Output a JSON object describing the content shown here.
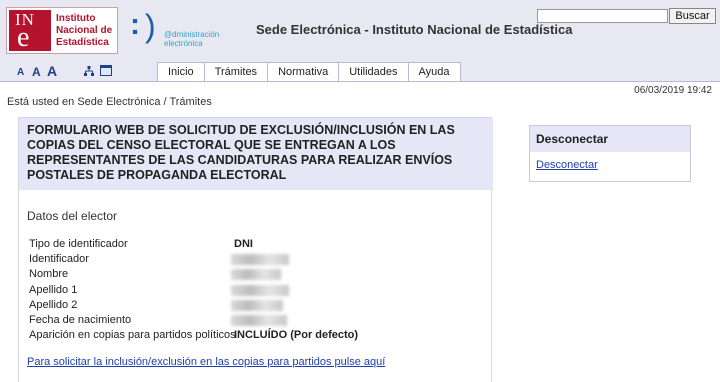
{
  "header": {
    "ine_logo": {
      "mark_line1": "IN",
      "mark_line2": "e",
      "words": [
        "Instituto",
        "Nacional de",
        "Estadística"
      ]
    },
    "admin_logo": {
      "line1": "@dministración",
      "line2": "electrónica"
    },
    "site_title": "Sede Electrónica - Instituto Nacional de Estadística",
    "search": {
      "value": "",
      "button_label": "Buscar"
    }
  },
  "toolbar": {
    "font_sizes": [
      "A",
      "A",
      "A"
    ],
    "icons": [
      "sitemap-icon",
      "window-icon"
    ]
  },
  "nav": {
    "tabs": [
      {
        "label": "Inicio"
      },
      {
        "label": "Trámites"
      },
      {
        "label": "Normativa"
      },
      {
        "label": "Utilidades"
      },
      {
        "label": "Ayuda"
      }
    ]
  },
  "timestamp": "06/03/2019 19:42",
  "breadcrumb": "Está usted en Sede Electrónica / Trámites",
  "form": {
    "title": "FORMULARIO WEB DE SOLICITUD DE EXCLUSIÓN/INCLUSIÓN EN LAS COPIAS DEL CENSO ELECTORAL QUE SE ENTREGAN A LOS REPRESENTANTES DE LAS CANDIDATURAS PARA REALIZAR ENVÍOS POSTALES DE PROPAGANDA ELECTORAL",
    "section_title": "Datos del elector",
    "fields": [
      {
        "label": "Tipo de identificador",
        "value": "DNI"
      },
      {
        "label": "Identificador",
        "value": ""
      },
      {
        "label": "Nombre",
        "value": ""
      },
      {
        "label": "Apellido 1",
        "value": ""
      },
      {
        "label": "Apellido 2",
        "value": ""
      },
      {
        "label": "Fecha de nacimiento",
        "value": ""
      },
      {
        "label": "Aparición en copias para partidos políticos",
        "value": "INCLUÍDO (Por defecto)"
      }
    ],
    "link": "Para solicitar la inclusión/exclusión en las copias para partidos pulse aquí"
  },
  "side_panel": {
    "title": "Desconectar",
    "link": "Desconectar"
  },
  "colors": {
    "accent": "#b5122d",
    "header_bg": "#e8e8f2",
    "title_bg": "#e6e6f7",
    "link": "#1f3fb0"
  }
}
